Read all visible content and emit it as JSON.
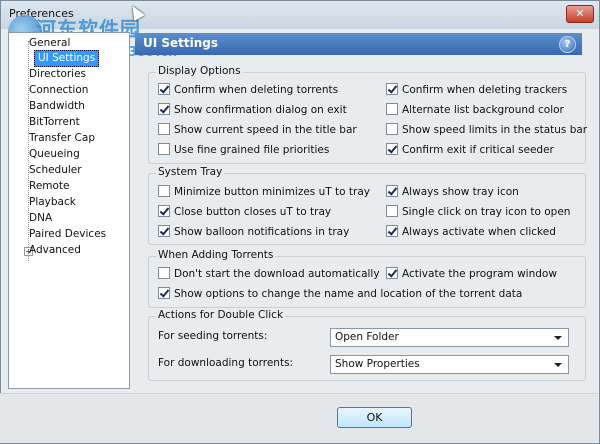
{
  "window": {
    "title": "Preferences",
    "close_glyph": "✕"
  },
  "watermark": {
    "line1": "河东软件园",
    "line2": "www.pc0359.cn"
  },
  "sidebar": {
    "items": [
      {
        "label": "General"
      },
      {
        "label": "UI Settings"
      },
      {
        "label": "Directories"
      },
      {
        "label": "Connection"
      },
      {
        "label": "Bandwidth"
      },
      {
        "label": "BitTorrent"
      },
      {
        "label": "Transfer Cap"
      },
      {
        "label": "Queueing"
      },
      {
        "label": "Scheduler"
      },
      {
        "label": "Remote"
      },
      {
        "label": "Playback"
      },
      {
        "label": "DNA"
      },
      {
        "label": "Paired Devices"
      },
      {
        "label": "Advanced"
      }
    ],
    "advanced_expander": "+"
  },
  "header": {
    "title": "UI Settings",
    "help_glyph": "?"
  },
  "display_options": {
    "title": "Display Options",
    "items": [
      {
        "label": "Confirm when deleting torrents",
        "checked": true
      },
      {
        "label": "Confirm when deleting trackers",
        "checked": true
      },
      {
        "label": "Show confirmation dialog on exit",
        "checked": true
      },
      {
        "label": "Alternate list background color",
        "checked": false
      },
      {
        "label": "Show current speed in the title bar",
        "checked": false
      },
      {
        "label": "Show speed limits in the status bar",
        "checked": false
      },
      {
        "label": "Use fine grained file priorities",
        "checked": false
      },
      {
        "label": "Confirm exit if critical seeder",
        "checked": true
      }
    ]
  },
  "system_tray": {
    "title": "System Tray",
    "items": [
      {
        "label": "Minimize button minimizes uT to tray",
        "checked": false
      },
      {
        "label": "Always show tray icon",
        "checked": true
      },
      {
        "label": "Close button closes uT to tray",
        "checked": true
      },
      {
        "label": "Single click on tray icon to open",
        "checked": false
      },
      {
        "label": "Show balloon notifications in tray",
        "checked": true
      },
      {
        "label": "Always activate when clicked",
        "checked": true
      }
    ]
  },
  "adding_torrents": {
    "title": "When Adding Torrents",
    "items": [
      {
        "label": "Don't start the download automatically",
        "checked": false
      },
      {
        "label": "Activate the program window",
        "checked": true
      },
      {
        "label": "Show options to change the name and location of the torrent data",
        "checked": true
      }
    ]
  },
  "double_click": {
    "title": "Actions for Double Click",
    "seeding_label": "For seeding torrents:",
    "seeding_value": "Open Folder",
    "downloading_label": "For downloading torrents:",
    "downloading_value": "Show Properties"
  },
  "footer": {
    "ok_label": "OK"
  }
}
